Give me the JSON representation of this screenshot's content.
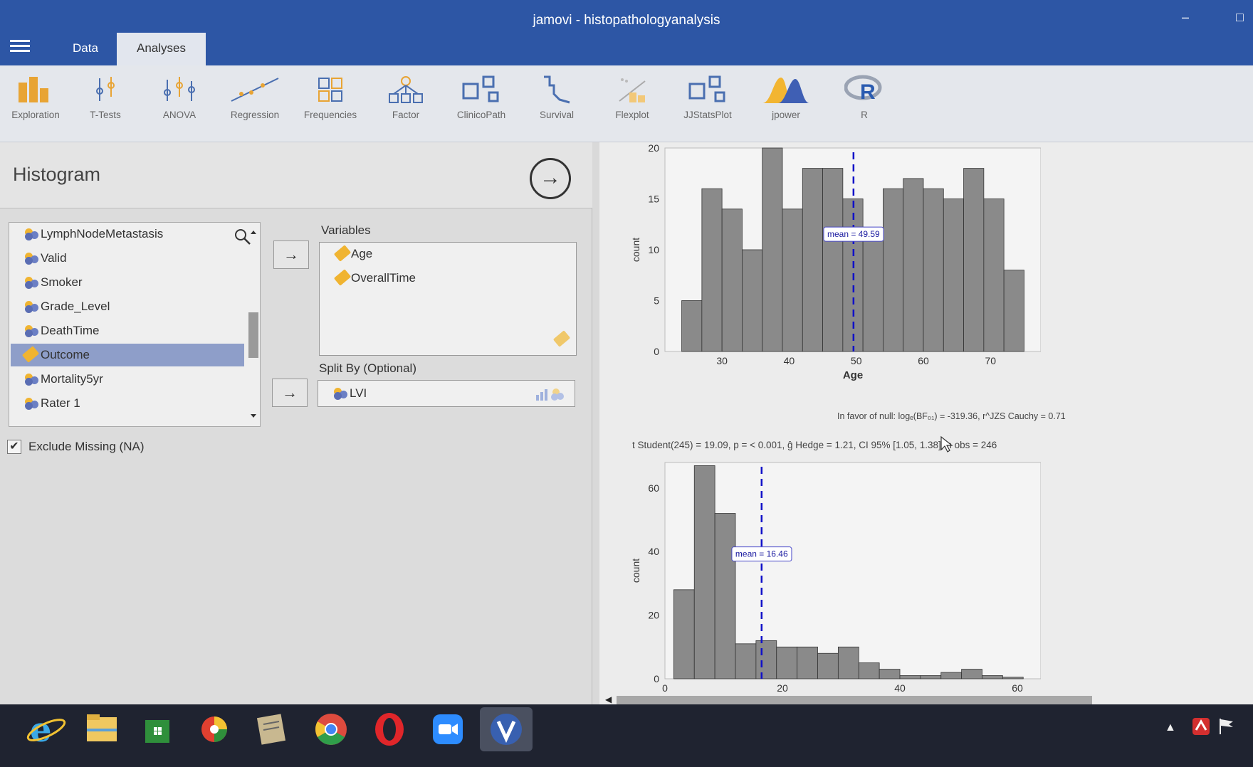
{
  "window": {
    "title": "jamovi - histopathologyanalysis",
    "minimize": "–",
    "maximize": "□"
  },
  "tabs": [
    {
      "label": "Data"
    },
    {
      "label": "Analyses"
    }
  ],
  "ribbon": [
    {
      "label": "Exploration",
      "icon": "exploration-icon"
    },
    {
      "label": "T-Tests",
      "icon": "t-tests-icon"
    },
    {
      "label": "ANOVA",
      "icon": "anova-icon"
    },
    {
      "label": "Regression",
      "icon": "regression-icon"
    },
    {
      "label": "Frequencies",
      "icon": "frequencies-icon"
    },
    {
      "label": "Factor",
      "icon": "factor-icon"
    },
    {
      "label": "ClinicoPath",
      "icon": "clinicopath-icon"
    },
    {
      "label": "Survival",
      "icon": "survival-icon"
    },
    {
      "label": "Flexplot",
      "icon": "flexplot-icon"
    },
    {
      "label": "JJStatsPlot",
      "icon": "jjstatsplot-icon"
    },
    {
      "label": "jpower",
      "icon": "jpower-icon"
    },
    {
      "label": "R",
      "icon": "r-icon"
    }
  ],
  "options": {
    "title": "Histogram",
    "variables": [
      {
        "label": "LymphNodeMetastasis",
        "type": "nominal",
        "selected": false
      },
      {
        "label": "Valid",
        "type": "nominal",
        "selected": false
      },
      {
        "label": "Smoker",
        "type": "nominal",
        "selected": false
      },
      {
        "label": "Grade_Level",
        "type": "nominal",
        "selected": false
      },
      {
        "label": "DeathTime",
        "type": "nominal",
        "selected": false
      },
      {
        "label": "Outcome",
        "type": "continuous",
        "selected": true
      },
      {
        "label": "Mortality5yr",
        "type": "nominal",
        "selected": false
      },
      {
        "label": "Rater 1",
        "type": "nominal",
        "selected": false
      }
    ],
    "variables_label": "Variables",
    "assigned_variables": [
      {
        "label": "Age",
        "type": "continuous"
      },
      {
        "label": "OverallTime",
        "type": "continuous"
      }
    ],
    "split_label": "Split By (Optional)",
    "split_variable": {
      "label": "LVI",
      "type": "nominal"
    },
    "exclude_missing": {
      "label": "Exclude Missing (NA)",
      "checked": true
    },
    "move_arrow": "→"
  },
  "results": {
    "stats_bf": "In favor of null: logₑ(BF₀₁) = -319.36, r^JZS Cauchy = 0.71",
    "stats_t": "t Student(245) = 19.09, p = < 0.001, ĝ Hedge = 1.21, CI 95% [1.05, 1.38], n obs = 246",
    "left_arrow": "◀"
  },
  "chart_data": [
    {
      "type": "bar",
      "title": "",
      "xlabel": "Age",
      "ylabel": "count",
      "x_ticks": [
        30,
        40,
        50,
        60,
        70
      ],
      "y_ticks": [
        0,
        5,
        10,
        15,
        20
      ],
      "xlim": [
        21.5,
        77.5
      ],
      "ylim": [
        0,
        20
      ],
      "bin_start": 24,
      "bin_width": 3,
      "values": [
        5,
        16,
        14,
        10,
        20,
        14,
        18,
        18,
        15,
        11,
        16,
        17,
        16,
        15,
        18,
        15,
        8
      ],
      "mean": 49.59,
      "mean_label": "mean = 49.59",
      "colors": {
        "bar": "#8a8a8a",
        "mean_line": "#1010c8"
      }
    },
    {
      "type": "bar",
      "title": "",
      "xlabel": "",
      "ylabel": "count",
      "x_ticks": [
        0,
        20,
        40,
        60
      ],
      "y_ticks": [
        0,
        20,
        40,
        60
      ],
      "xlim": [
        0,
        64
      ],
      "ylim": [
        0,
        68
      ],
      "bin_start": 1.5,
      "bin_width": 3.5,
      "values": [
        28,
        67,
        52,
        11,
        12,
        10,
        10,
        8,
        10,
        5,
        3,
        1,
        1,
        2,
        3,
        1,
        0.5
      ],
      "mean": 16.46,
      "mean_label": "mean = 16.46",
      "colors": {
        "bar": "#8a8a8a",
        "mean_line": "#1010c8"
      }
    }
  ]
}
